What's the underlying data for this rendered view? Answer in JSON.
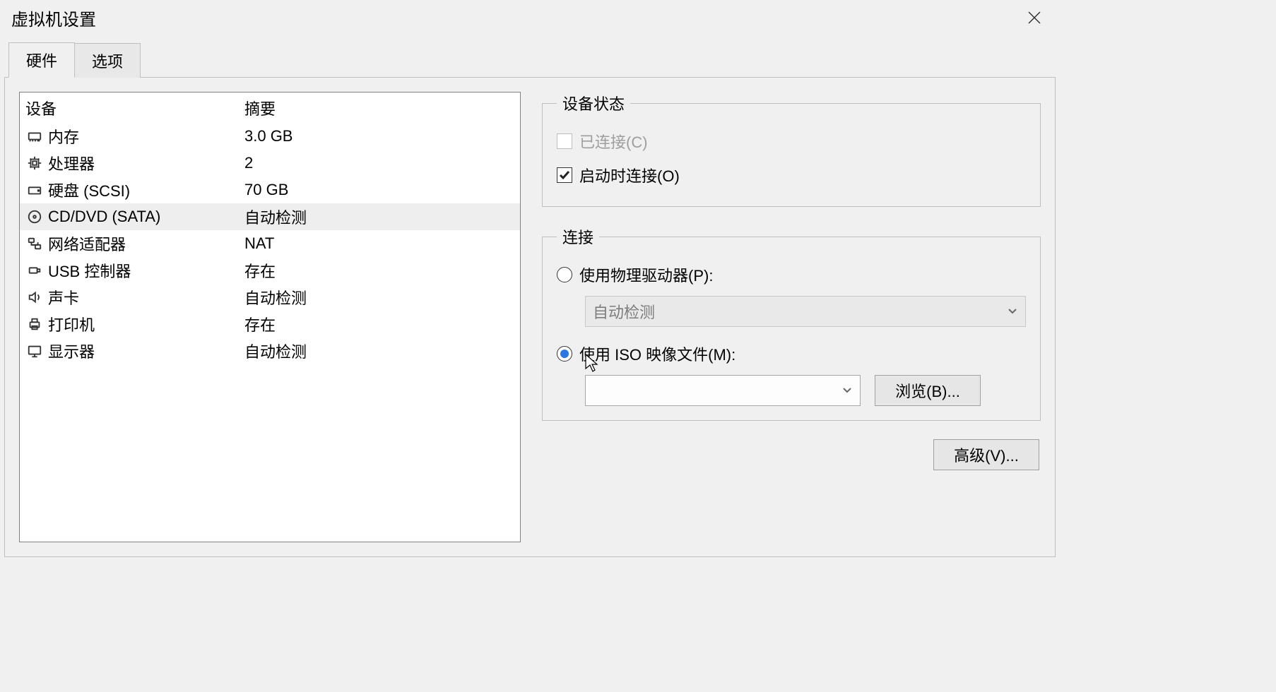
{
  "window": {
    "title": "虚拟机设置"
  },
  "tabs": {
    "hardware": "硬件",
    "options": "选项"
  },
  "device_table": {
    "col_device": "设备",
    "col_summary": "摘要",
    "rows": [
      {
        "icon": "memory",
        "label": "内存",
        "summary": "3.0 GB",
        "selected": false
      },
      {
        "icon": "cpu",
        "label": "处理器",
        "summary": "2",
        "selected": false
      },
      {
        "icon": "disk",
        "label": "硬盘 (SCSI)",
        "summary": "70 GB",
        "selected": false
      },
      {
        "icon": "cd",
        "label": "CD/DVD (SATA)",
        "summary": "自动检测",
        "selected": true
      },
      {
        "icon": "network",
        "label": "网络适配器",
        "summary": "NAT",
        "selected": false
      },
      {
        "icon": "usb",
        "label": "USB 控制器",
        "summary": "存在",
        "selected": false
      },
      {
        "icon": "sound",
        "label": "声卡",
        "summary": "自动检测",
        "selected": false
      },
      {
        "icon": "printer",
        "label": "打印机",
        "summary": "存在",
        "selected": false
      },
      {
        "icon": "display",
        "label": "显示器",
        "summary": "自动检测",
        "selected": false
      }
    ]
  },
  "device_status": {
    "legend": "设备状态",
    "connected_label": "已连接(C)",
    "connected_checked": false,
    "connected_enabled": false,
    "connect_at_power_label": "启动时连接(O)",
    "connect_at_power_checked": true
  },
  "connection": {
    "legend": "连接",
    "physical_label": "使用物理驱动器(P):",
    "physical_selected": false,
    "physical_combo_value": "自动检测",
    "iso_label": "使用 ISO 映像文件(M):",
    "iso_selected": true,
    "iso_combo_value": "",
    "browse_button": "浏览(B)..."
  },
  "advanced_button": "高级(V)..."
}
